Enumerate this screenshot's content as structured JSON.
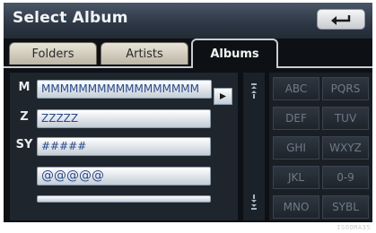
{
  "title": "Select Album",
  "back_icon": "return-arrow-icon",
  "tabs": [
    {
      "label": "Folders",
      "active": false
    },
    {
      "label": "Artists",
      "active": false
    },
    {
      "label": "Albums",
      "active": true
    }
  ],
  "list": {
    "rows": [
      {
        "letter": "M",
        "value": "MMMMMMMMMMMMMMMMM"
      },
      {
        "letter": "Z",
        "value": "ZZZZZ"
      },
      {
        "letter": "SY",
        "value": "#####"
      },
      {
        "letter": "",
        "value": "@@@@@"
      }
    ],
    "play_icon": "play-icon"
  },
  "scroll": {
    "up_icon": "scroll-up-icon",
    "down_icon": "scroll-down-icon"
  },
  "keys": [
    "ABC",
    "PQRS",
    "DEF",
    "TUV",
    "GHI",
    "WXYZ",
    "JKL",
    "0-9",
    "MNO",
    "SYBL"
  ],
  "colors": {
    "key_text": "#6f7a86",
    "field_text": "#2a4a8a",
    "title_text": "#f2f4f6"
  },
  "watermark": "ISOOMA35"
}
